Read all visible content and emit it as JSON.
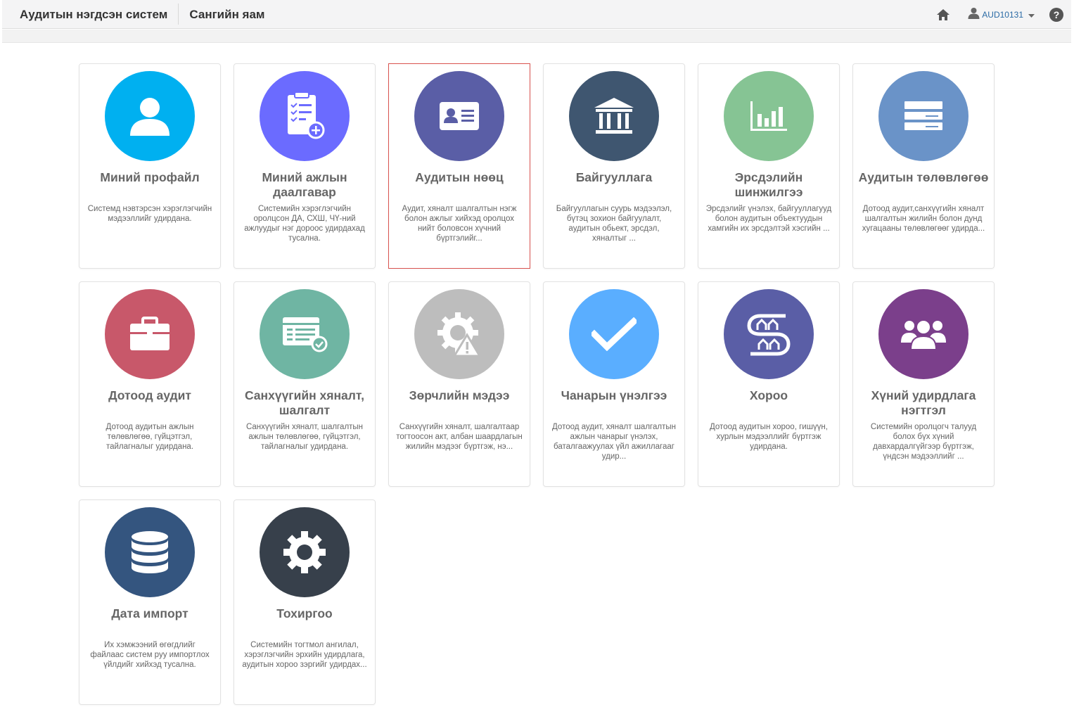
{
  "header": {
    "app_title": "Аудитын нэгдсэн систем",
    "org_title": "Сангийн яам",
    "home_icon": "home-icon",
    "user_icon": "user-icon",
    "username": "AUD10131",
    "help_icon": "help-icon"
  },
  "modules": [
    {
      "title": "Миний профайл",
      "description": "Системд нэвтэрсэн хэрэглэгчийн мэдээллийг удирдана.",
      "color": "#00b0f0",
      "icon": "user-profile-icon"
    },
    {
      "title": "Миний ажлын даалгавар",
      "description": "Системийн хэрэглэгчийн оролцсон ДА, СХШ, ЧҮ-ний ажлуудыг нэг дороос удирдахад тусална.",
      "color": "#6b6bff",
      "icon": "task-clipboard-icon"
    },
    {
      "title": "Аудитын нөөц",
      "description": "Аудит, хяналт шалгалтын нэгж болон ажлыг хийхэд оролцох нийт боловсон хүчний бүртгэлийг...",
      "color": "#5a5ea6",
      "icon": "id-card-icon"
    },
    {
      "title": "Байгууллага",
      "description": "Байгууллагын суурь мэдээлэл, бүтэц зохион байгуулалт, аудитын обьект, эрсдэл, хяналтыг ...",
      "color": "#3f5670",
      "icon": "institution-icon"
    },
    {
      "title": "Эрсдэлийн шинжилгээ",
      "description": "Эрсдэлийг үнэлэх, байгууллагууд болон аудитын объектуудын хамгийн их эрсдэлтэй хэсгийн ...",
      "color": "#86c494",
      "icon": "bar-chart-icon"
    },
    {
      "title": "Аудитын төлөвлөгөө",
      "description": "Дотоод аудит,санхүүгийн хяналт шалгалтын жилийн болон дунд хугацааны төлөвлөгөөг удирда...",
      "color": "#6a93c8",
      "icon": "plan-list-icon"
    },
    {
      "title": "Дотоод аудит",
      "description": "Дотоод аудитын ажлын төлөвлөгөө, гүйцэтгэл, тайлагналыг удирдана.",
      "color": "#c8586a",
      "icon": "briefcase-icon"
    },
    {
      "title": "Санхүүгийн хяналт, шалгалт",
      "description": "Санхүүгийн хяналт, шалгалтын ажлын төлөвлөгөө, гүйцэтгэл, тайлагналыг удирдана.",
      "color": "#6fb5a3",
      "icon": "form-check-icon"
    },
    {
      "title": "Зөрчлийн мэдээ",
      "description": "Санхүүгийн хяналт, шалгалтаар тогтоосон акт, албан шаардлагын жилийн мэдээг бүртгэж, нэ...",
      "color": "#bdbdbd",
      "icon": "gear-warning-icon"
    },
    {
      "title": "Чанарын үнэлгээ",
      "description": "Дотоод аудит, хяналт шалгалтын ажлын чанарыг үнэлэх, баталгаажуулах үйл ажиллагааг удир...",
      "color": "#5aaeff",
      "icon": "checkmark-icon"
    },
    {
      "title": "Хороо",
      "description": "Дотоод аудитын хороо, гишүүн, хурлын мэдээллийг бүртгэж удирдана.",
      "color": "#5a5ea6",
      "icon": "committee-icon"
    },
    {
      "title": "Хүний удирдлага нэгтгэл",
      "description": "Системийн оролцогч талууд болох бүх хүний давхардалгүйгээр бүртгэж, үндсэн мэдээллийг ...",
      "color": "#7b3f8b",
      "icon": "people-group-icon"
    },
    {
      "title": "Дата импорт",
      "description": "Их хэмжээний өгөгдлийг файлаас систем руу импортлох үйлдийг хийхэд тусална.",
      "color": "#34557f",
      "icon": "database-icon"
    },
    {
      "title": "Тохиргоо",
      "description": "Системийн тогтмол ангилал, хэрэглэгчийн эрхийн удирдлага, аудитын хороо зэргийг удирдах...",
      "color": "#37404b",
      "icon": "settings-gear-icon"
    }
  ]
}
